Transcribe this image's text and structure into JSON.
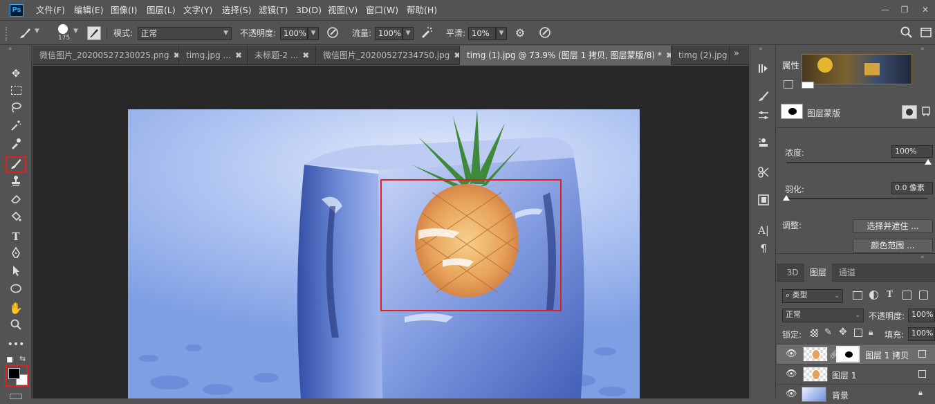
{
  "app": {
    "logo": "Ps"
  },
  "menu": [
    "文件(F)",
    "编辑(E)",
    "图像(I)",
    "图层(L)",
    "文字(Y)",
    "选择(S)",
    "滤镜(T)",
    "3D(D)",
    "视图(V)",
    "窗口(W)",
    "帮助(H)"
  ],
  "window_controls": {
    "minimize": "—",
    "restore": "❐",
    "close": "✕"
  },
  "options": {
    "brush_size": "175",
    "mode_label": "模式:",
    "mode_value": "正常",
    "opacity_label": "不透明度:",
    "opacity_value": "100%",
    "flow_label": "流量:",
    "flow_value": "100%",
    "smooth_label": "平滑:",
    "smooth_value": "10%"
  },
  "tabs": [
    {
      "label": "微信图片_20200527230025.png",
      "close": "✖"
    },
    {
      "label": "timg.jpg ...",
      "close": "✖"
    },
    {
      "label": "未标题-2 ...",
      "close": "✖"
    },
    {
      "label": "微信图片_20200527234750.jpg",
      "close": "✖"
    },
    {
      "label": "timg (1).jpg @ 73.9% (图层 1 拷贝, 图层蒙版/8) *",
      "close": "✖"
    },
    {
      "label": "timg (2).jpg",
      "close": ""
    }
  ],
  "tabs_overflow": "»",
  "properties": {
    "title": "属性",
    "mask_label": "图层蒙版",
    "density_label": "浓度:",
    "density_value": "100%",
    "feather_label": "羽化:",
    "feather_value": "0.0 像素",
    "adjust_label": "调整:",
    "select_mask_button": "选择并遮住 ...",
    "color_range_button": "颜色范围 ..."
  },
  "layers_panel": {
    "tabs": [
      "3D",
      "图层",
      "通道"
    ],
    "active_tab": "图层",
    "filter_kind": "类型",
    "blend_mode": "正常",
    "opacity_label": "不透明度:",
    "opacity_value": "100%",
    "lock_label": "锁定:",
    "fill_label": "填充:",
    "fill_value": "100%",
    "layers": [
      {
        "name": "图层 1 拷贝"
      },
      {
        "name": "图层 1"
      },
      {
        "name": "背景"
      }
    ]
  },
  "colors": {
    "highlight_red": "#e02020",
    "foreground": "#000000",
    "background": "#ffffff"
  }
}
